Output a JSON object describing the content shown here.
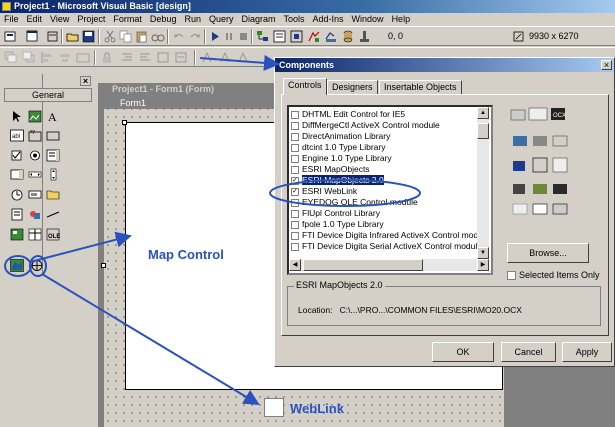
{
  "window": {
    "title": "Project1 - Microsoft Visual Basic [design]"
  },
  "menu": [
    "File",
    "Edit",
    "View",
    "Project",
    "Format",
    "Debug",
    "Run",
    "Query",
    "Diagram",
    "Tools",
    "Add-Ins",
    "Window",
    "Help"
  ],
  "toolbar": {
    "position": "0, 0",
    "size": "9930 x 6270"
  },
  "toolbox": {
    "tab_label": "General",
    "close": "×"
  },
  "project_window": {
    "title": "Project1 - Form1 (Form)"
  },
  "form": {
    "title": "Form1"
  },
  "annotations": {
    "map_control": "Map Control",
    "weblink": "WebLink"
  },
  "dialog": {
    "title": "Components",
    "close": "×",
    "tabs": [
      "Controls",
      "Designers",
      "Insertable Objects"
    ],
    "items": [
      {
        "label": "DHTML Edit Control for IE5",
        "checked": false,
        "selected": false
      },
      {
        "label": "DiffMergeCtl ActiveX Control module",
        "checked": false,
        "selected": false
      },
      {
        "label": "DirectAnimation Library",
        "checked": false,
        "selected": false
      },
      {
        "label": "dtcint 1.0 Type Library",
        "checked": false,
        "selected": false
      },
      {
        "label": "Engine 1.0 Type Library",
        "checked": false,
        "selected": false
      },
      {
        "label": "ESRI MapObjects",
        "checked": false,
        "selected": false
      },
      {
        "label": "ESRI MapObjects 2.0",
        "checked": true,
        "selected": true
      },
      {
        "label": "ESRI WebLink",
        "checked": true,
        "selected": false
      },
      {
        "label": "EYEDOG OLE Control module",
        "checked": false,
        "selected": false
      },
      {
        "label": "FlUpl Control Library",
        "checked": false,
        "selected": false
      },
      {
        "label": "fpole 1.0 Type Library",
        "checked": false,
        "selected": false
      },
      {
        "label": "FTI Device Digita Infrared ActiveX Control modu",
        "checked": false,
        "selected": false
      },
      {
        "label": "FTI Device Digita Serial ActiveX Control module",
        "checked": false,
        "selected": false
      }
    ],
    "browse_label": "Browse...",
    "selected_only_label": "Selected Items Only",
    "group_title": "ESRI MapObjects 2.0",
    "location_label": "Location:",
    "location_value": "C:\\...\\PRO...\\COMMON FILES\\ESRI\\MO20.OCX",
    "ok_label": "OK",
    "cancel_label": "Cancel",
    "apply_label": "Apply"
  }
}
